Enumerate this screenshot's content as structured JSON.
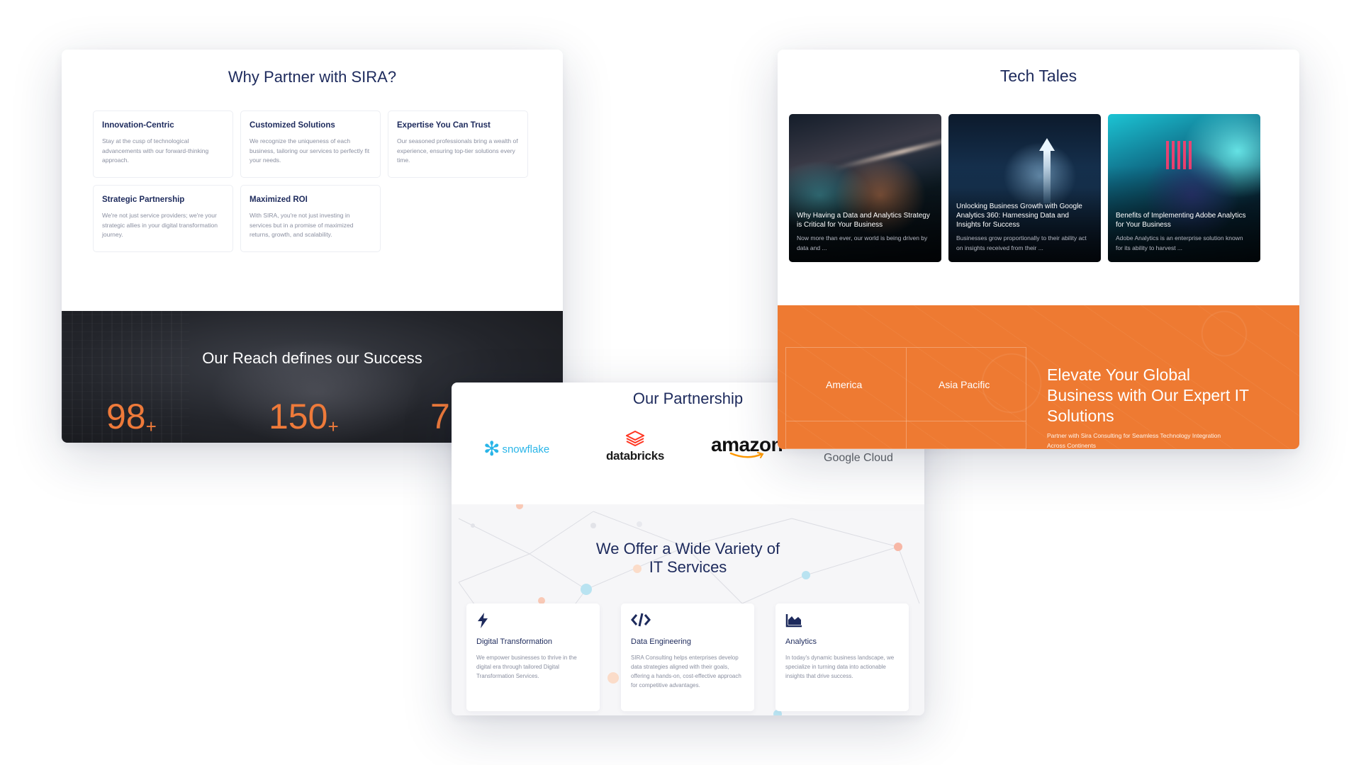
{
  "why_partner": {
    "title": "Why Partner with SIRA?",
    "features": [
      {
        "title": "Innovation-Centric",
        "text": "Stay at the cusp of technological advancements with our forward-thinking approach."
      },
      {
        "title": "Customized Solutions",
        "text": "We recognize the uniqueness of each business, tailoring our services to perfectly fit your needs."
      },
      {
        "title": "Expertise You Can Trust",
        "text": "Our seasoned professionals bring a wealth of experience, ensuring top-tier solutions every time."
      },
      {
        "title": "Strategic Partnership",
        "text": "We're not just service providers; we're your strategic allies in your digital transformation journey."
      },
      {
        "title": "Maximized ROI",
        "text": "With SIRA, you're not just investing in services but in a promise of maximized returns, growth, and scalability."
      }
    ],
    "reach_title": "Our Reach defines our Success",
    "stats": [
      {
        "value": "98",
        "suffix": "+"
      },
      {
        "value": "150",
        "suffix": "+"
      },
      {
        "value": "7",
        "suffix": ""
      }
    ]
  },
  "tech_tales": {
    "title": "Tech Tales",
    "posts": [
      {
        "title": "Why Having a Data and Analytics Strategy is Critical for Your Business",
        "excerpt": "Now more than ever, our world is being driven by data and ..."
      },
      {
        "title": "Unlocking Business Growth with Google Analytics 360: Harnessing Data and Insights for Success",
        "excerpt": "Businesses grow proportionally to their ability act on insights received from their ..."
      },
      {
        "title": "Benefits of Implementing Adobe Analytics for Your Business",
        "excerpt": "Adobe Analytics is an enterprise solution known for its ability to harvest ..."
      }
    ],
    "regions": [
      "America",
      "Asia Pacific"
    ],
    "cta_title": "Elevate Your Global Business with Our Expert IT Solutions",
    "cta_text": "Partner with Sira Consulting for Seamless Technology Integration Across Continents"
  },
  "partnership": {
    "title": "Our Partnership",
    "logos": {
      "snowflake": "snowflake",
      "databricks": "databricks",
      "amazon": "amazon",
      "google_cloud": "Google Cloud"
    },
    "offer_title_line1": "We Offer a Wide Variety of",
    "offer_title_line2": "IT Services",
    "services": [
      {
        "icon": "bolt-icon",
        "title": "Digital Transformation",
        "text": "We empower businesses to thrive in the digital era through tailored Digital Transformation Services."
      },
      {
        "icon": "code-icon",
        "title": "Data Engineering",
        "text": "SIRA Consulting helps enterprises develop data strategies aligned with their goals, offering a hands-on, cost-effective approach for competitive advantages."
      },
      {
        "icon": "area-chart-icon",
        "title": "Analytics",
        "text": "In today's dynamic business landscape, we specialize in turning data into actionable insights that drive success."
      }
    ]
  },
  "colors": {
    "navy": "#1d2a5c",
    "orange": "#ee7a32",
    "stat_orange": "#ee7a3a",
    "snowflake_blue": "#29b5e8",
    "databricks_red": "#ff3621"
  }
}
